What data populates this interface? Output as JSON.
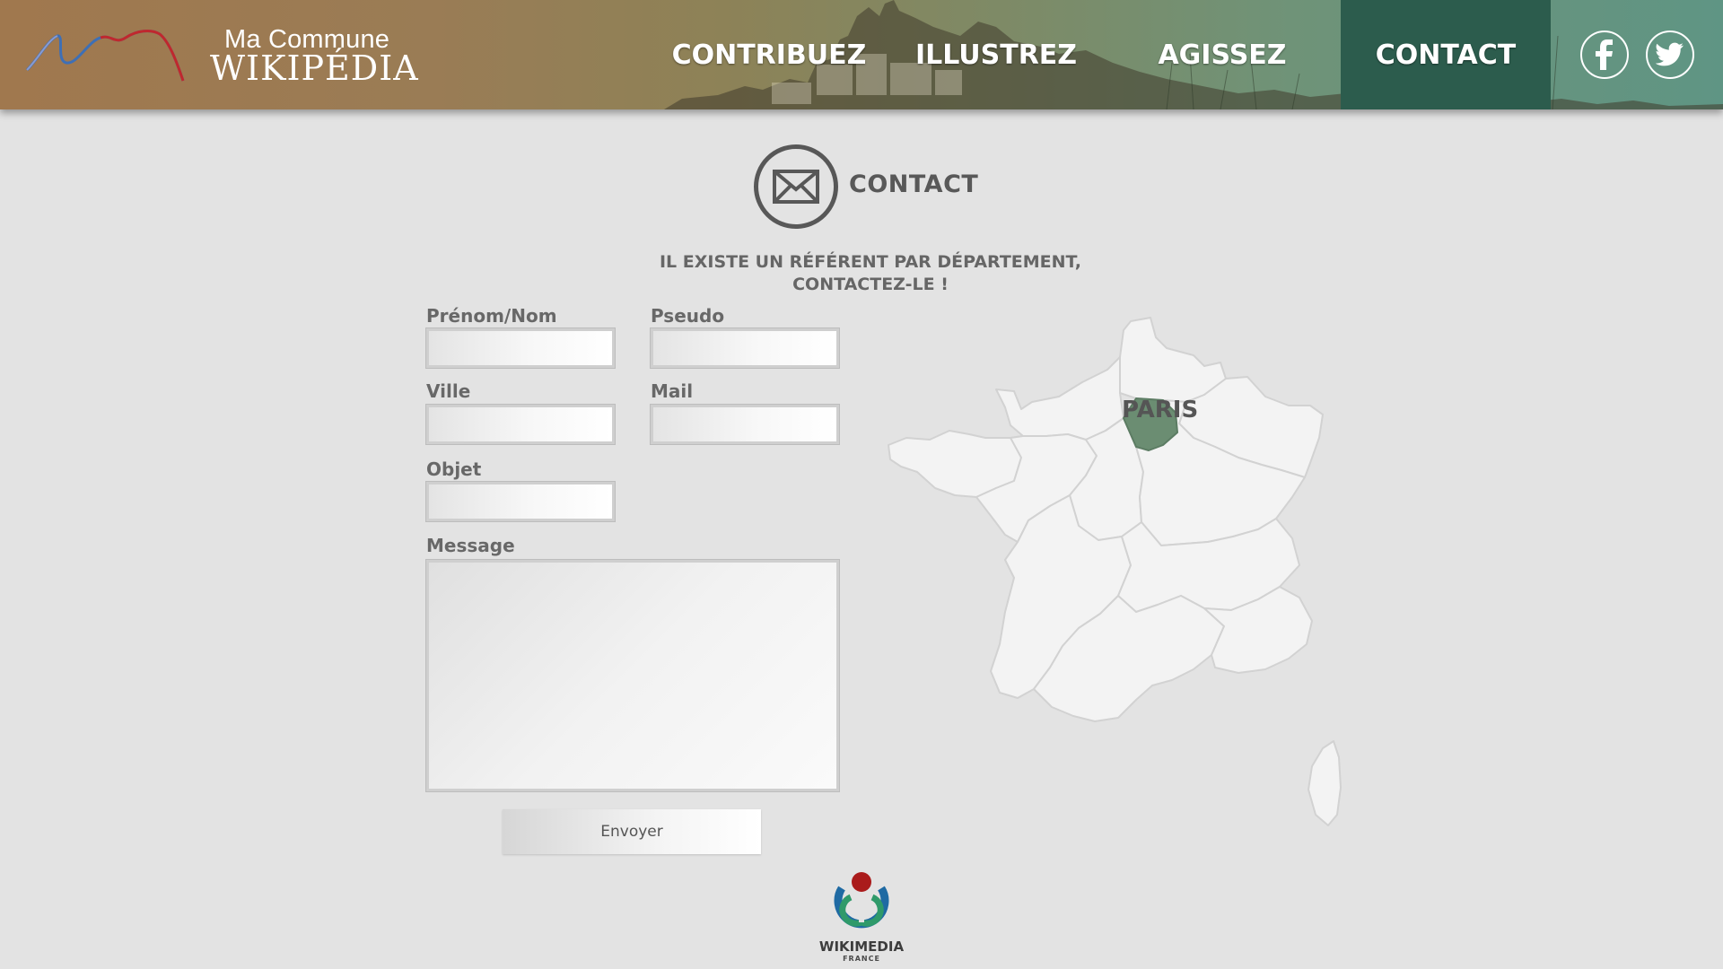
{
  "header": {
    "logo_top": "Ma Commune",
    "logo_main": "WIKIPÉDIA",
    "nav": {
      "contribuez": "CONTRIBUEZ",
      "illustrez": "ILLUSTREZ",
      "agissez": "AGISSEZ",
      "contact": "CONTACT"
    },
    "social": {
      "facebook_icon": "facebook-icon",
      "twitter_icon": "twitter-icon"
    }
  },
  "contact": {
    "title": "CONTACT",
    "icon": "envelope-icon",
    "subtitle_line1": "IL EXISTE UN RÉFÉRENT PAR DÉPARTEMENT,",
    "subtitle_line2": "CONTACTEZ-LE !"
  },
  "form": {
    "name_label": "Prénom/Nom",
    "name_value": "",
    "pseudo_label": "Pseudo",
    "pseudo_value": "",
    "ville_label": "Ville",
    "ville_value": "",
    "mail_label": "Mail",
    "mail_value": "",
    "objet_label": "Objet",
    "objet_value": "",
    "message_label": "Message",
    "message_value": "",
    "submit_label": "Envoyer"
  },
  "map": {
    "selected_region_label": "PARIS",
    "selected_color": "#6b8d72",
    "region_color": "#f3f3f3"
  },
  "footer": {
    "logo_name": "WIKIMEDIA",
    "logo_sub": "FRANCE"
  },
  "colors": {
    "background": "#e3e3e3",
    "active_nav": "#2c5c4d",
    "text_dark": "#585858"
  }
}
